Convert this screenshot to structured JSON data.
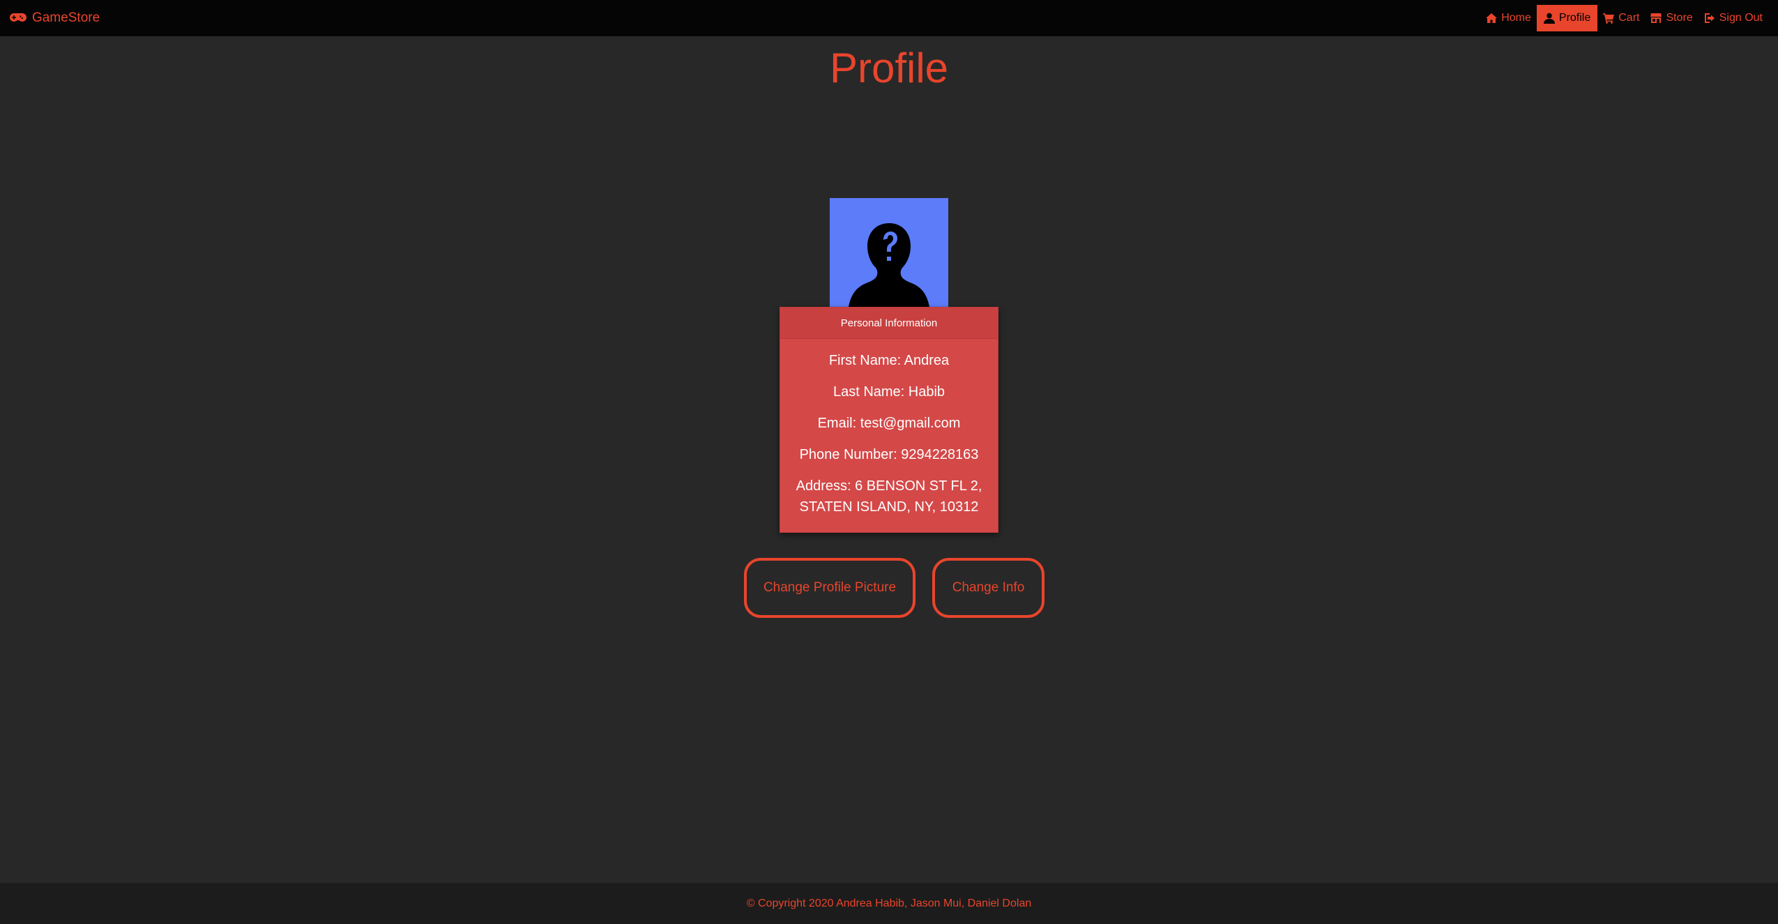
{
  "brand": {
    "name": "GameStore",
    "icon": "gamepad-icon"
  },
  "nav": [
    {
      "label": "Home",
      "icon": "home-icon",
      "active": false
    },
    {
      "label": "Profile",
      "icon": "user-icon",
      "active": true
    },
    {
      "label": "Cart",
      "icon": "cart-icon",
      "active": false
    },
    {
      "label": "Store",
      "icon": "store-icon",
      "active": false
    },
    {
      "label": "Sign Out",
      "icon": "sign-out-icon",
      "active": false
    }
  ],
  "page": {
    "title": "Profile"
  },
  "profile": {
    "avatar_icon": "unknown-user-silhouette-icon",
    "card_title": "Personal Information",
    "first_name": "First Name: Andrea",
    "last_name": "Last Name: Habib",
    "email": "Email: test@gmail.com",
    "phone": "Phone Number: 9294228163",
    "address": "Address: 6 BENSON ST FL 2, STATEN ISLAND, NY, 10312"
  },
  "actions": {
    "change_picture": "Change Profile Picture",
    "change_info": "Change Info"
  },
  "footer": {
    "text": "© Copyright 2020 Andrea Habib, Jason Mui, Daniel Dolan"
  },
  "colors": {
    "accent": "#e8452c",
    "background": "#282828",
    "navbar": "#050505",
    "card": "#d44848",
    "avatar_bg": "#5c7cfa"
  }
}
